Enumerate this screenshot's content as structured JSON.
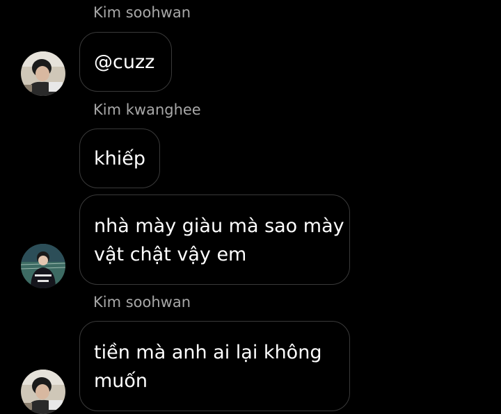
{
  "messages": [
    {
      "sender": "Kim soohwan",
      "text": "@cuzz"
    },
    {
      "sender": "Kim kwanghee",
      "text": "khiếp"
    },
    {
      "lines": [
        "nhà mày giàu mà sao mày",
        "vật chật vậy em"
      ]
    },
    {
      "sender": "Kim soohwan",
      "lines": [
        "tiền mà anh ai lại không",
        "muốn"
      ]
    }
  ],
  "avatars": [
    {
      "user": "Kim soohwan",
      "icon": "profile-photo-icon"
    },
    {
      "user": "Kim kwanghee",
      "icon": "profile-photo-icon"
    },
    {
      "user": "Kim soohwan",
      "icon": "profile-photo-icon"
    }
  ],
  "colors": {
    "background": "#000000",
    "bubble_border": "#3a3a3a",
    "sender_text": "#a8a8a8",
    "message_text": "#ffffff"
  }
}
